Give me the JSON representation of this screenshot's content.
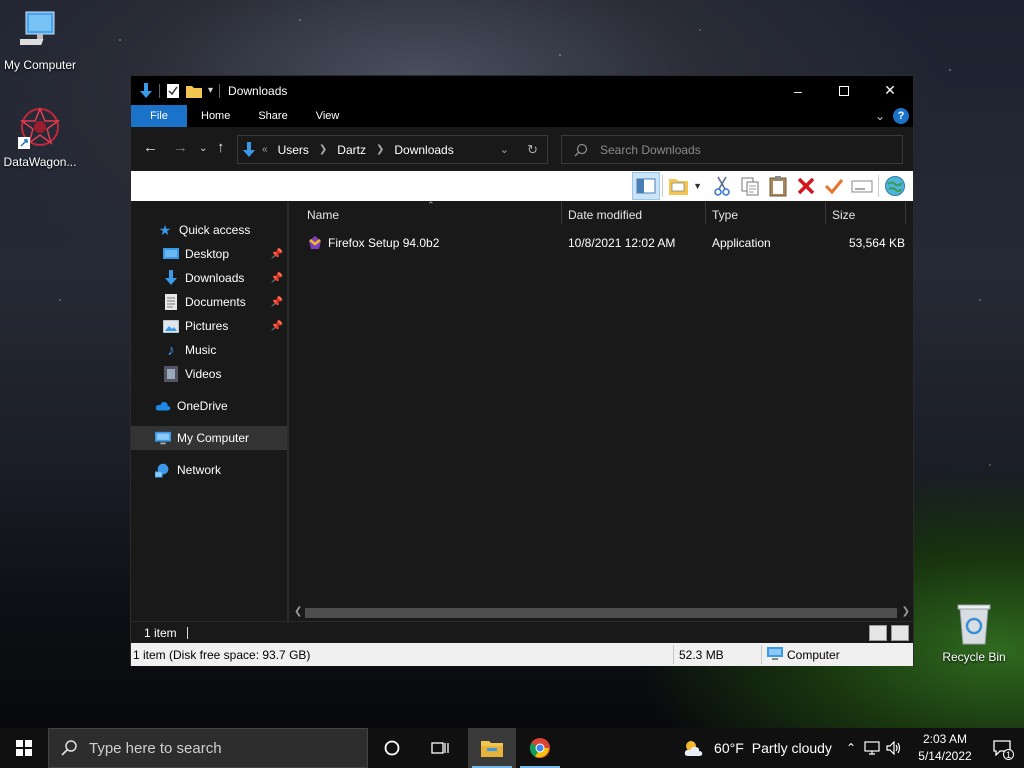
{
  "desktop": {
    "icons": [
      {
        "label": "My Computer",
        "icon": "computer-icon"
      },
      {
        "label": "DataWagon...",
        "icon": "datawagon-icon"
      },
      {
        "label": "Recycle Bin",
        "icon": "recycle-bin-icon"
      }
    ]
  },
  "window": {
    "title": "Downloads",
    "ribbon_tabs": [
      "File",
      "Home",
      "Share",
      "View"
    ],
    "help_label": "?",
    "address": {
      "overflow": "«",
      "crumbs": [
        "Users",
        "Dartz",
        "Downloads"
      ]
    },
    "search": {
      "placeholder": "Search Downloads"
    },
    "navigation": {
      "quick_access": "Quick access",
      "pinned": [
        {
          "label": "Desktop",
          "icon": "desktop-folder-icon"
        },
        {
          "label": "Downloads",
          "icon": "downloads-folder-icon"
        },
        {
          "label": "Documents",
          "icon": "documents-folder-icon"
        },
        {
          "label": "Pictures",
          "icon": "pictures-folder-icon"
        }
      ],
      "unpinned": [
        {
          "label": "Music",
          "icon": "music-folder-icon"
        },
        {
          "label": "Videos",
          "icon": "videos-folder-icon"
        }
      ],
      "onedrive": "OneDrive",
      "my_computer": "My Computer",
      "network": "Network"
    },
    "columns": [
      "Name",
      "Date modified",
      "Type",
      "Size"
    ],
    "files": [
      {
        "name": "Firefox Setup 94.0b2",
        "date": "10/8/2021 12:02 AM",
        "type": "Application",
        "size": "53,564 KB"
      }
    ],
    "status": {
      "item_count": "1 item",
      "detail": "1 item (Disk free space: 93.7 GB)",
      "selection_size": "52.3 MB",
      "location": "Computer"
    }
  },
  "taskbar": {
    "search_placeholder": "Type here to search",
    "weather": {
      "temp": "60°F",
      "condition": "Partly cloudy"
    },
    "time": "2:03 AM",
    "date": "5/14/2022",
    "notification_count": "1"
  },
  "colors": {
    "accent": "#1a73c8",
    "window_bg": "#191919",
    "titlebar_bg": "#000000",
    "taskbar_bg": "#101010"
  }
}
